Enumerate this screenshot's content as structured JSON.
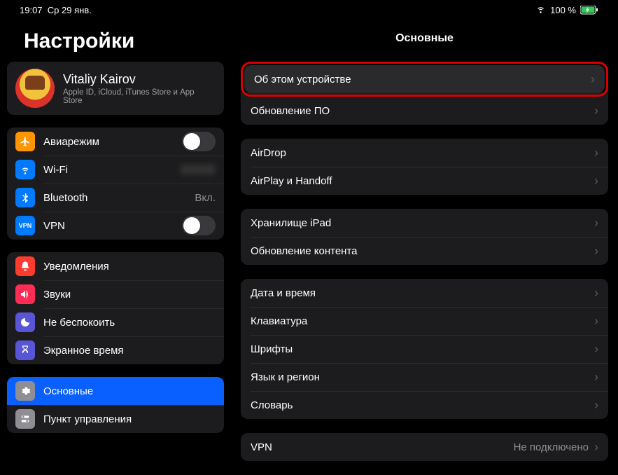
{
  "status": {
    "time": "19:07",
    "date": "Ср 29 янв.",
    "battery_pct": "100 %"
  },
  "sidebar": {
    "title": "Настройки",
    "profile": {
      "name": "Vitaliy Kairov",
      "sub": "Apple ID, iCloud, iTunes Store и App Store"
    },
    "group1": {
      "airplane": "Авиарежим",
      "wifi": "Wi-Fi",
      "wifi_value": "",
      "bluetooth": "Bluetooth",
      "bluetooth_value": "Вкл.",
      "vpn": "VPN"
    },
    "group2": {
      "notifications": "Уведомления",
      "sounds": "Звуки",
      "dnd": "Не беспокоить",
      "screentime": "Экранное время"
    },
    "group3": {
      "general": "Основные",
      "control": "Пункт управления"
    }
  },
  "main": {
    "title": "Основные",
    "about": "Об этом устройстве",
    "software": "Обновление ПО",
    "airdrop": "AirDrop",
    "airplay": "AirPlay и Handoff",
    "storage": "Хранилище iPad",
    "refresh": "Обновление контента",
    "datetime": "Дата и время",
    "keyboard": "Клавиатура",
    "fonts": "Шрифты",
    "lang": "Язык и регион",
    "dict": "Словарь",
    "vpn": "VPN",
    "vpn_value": "Не подключено"
  }
}
